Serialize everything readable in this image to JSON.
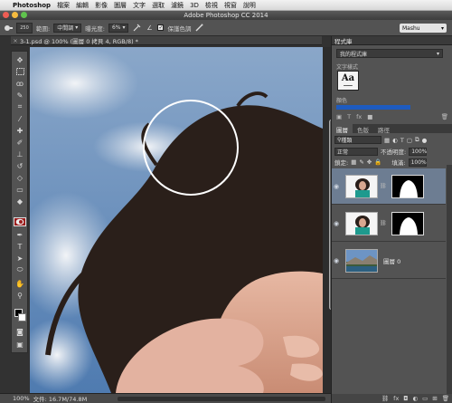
{
  "menubar": {
    "apple": "",
    "app_name": "Photoshop",
    "items": [
      "檔案",
      "編輯",
      "影像",
      "圖層",
      "文字",
      "選取",
      "濾鏡",
      "3D",
      "檢視",
      "視窗",
      "說明"
    ]
  },
  "window": {
    "title": "Adobe Photoshop CC 2014"
  },
  "options_bar": {
    "brush_size": "250",
    "range_label": "範圍:",
    "range_value": "中間調",
    "exposure_label": "曝光度:",
    "exposure_value": "6%",
    "protect_tones_label": "保護色調",
    "protect_tones_checked": "✓",
    "workspace": "Mashu"
  },
  "document": {
    "tab_title": "3-1.psd @ 100% (圖層 0 拷貝 4, RGB/8) *",
    "close_symbol": "×"
  },
  "status": {
    "zoom": "100%",
    "doc_size": "文件: 16.7M/74.8M"
  },
  "library_panel": {
    "title": "程式庫",
    "library_select": "我的程式庫",
    "section_character_styles": "文字樣式",
    "style_sample": "Aa",
    "section_colors": "顏色"
  },
  "layers_panel": {
    "tabs": [
      "圖層",
      "色版",
      "路徑"
    ],
    "active_tab": "圖層",
    "filter_kind": "種類",
    "blend_mode": "正常",
    "opacity_label": "不透明度:",
    "opacity_value": "100%",
    "lock_label": "鎖定:",
    "fill_label": "填滿:",
    "fill_value": "100%",
    "layers": [
      {
        "name": "",
        "has_mask": true,
        "selected": true
      },
      {
        "name": "",
        "has_mask": true,
        "selected": false
      },
      {
        "name": "圖層 0",
        "has_mask": false,
        "selected": false
      }
    ]
  },
  "colors": {
    "accent_selection": "#6d7d92",
    "active_tool_red": "#9b1c1c",
    "library_color_swatch": "#1e5bbf"
  }
}
